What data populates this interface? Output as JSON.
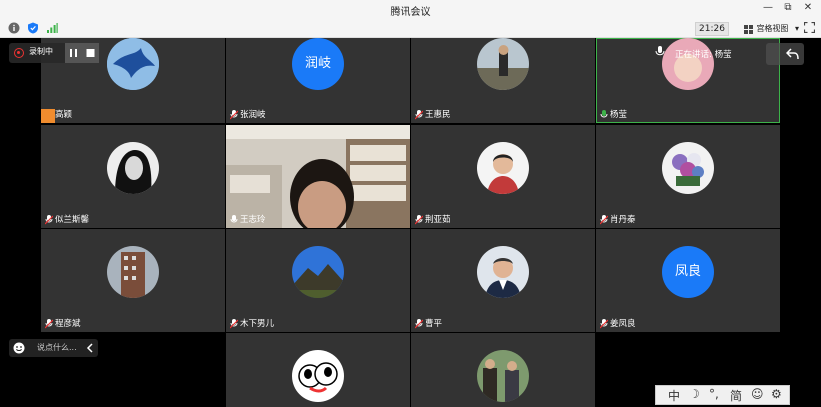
{
  "window": {
    "title": "腾讯会议",
    "min": "—",
    "restore": "⧉",
    "close": "✕"
  },
  "toolbar": {
    "time": "21:26",
    "grid_view_label": "宫格视图",
    "grid_view_arrow": "▾"
  },
  "recording": {
    "label": "录制中"
  },
  "speaking": {
    "label": "正在讲话: 杨莹"
  },
  "participants": [
    {
      "name": "高颖",
      "avatar": "bird"
    },
    {
      "name": "张润岐",
      "avatar_text": "润岐"
    },
    {
      "name": "王惠民",
      "avatar": "person-outdoor"
    },
    {
      "name": "杨莹",
      "avatar": "pink",
      "active": true
    },
    {
      "name": "似兰斯馨",
      "avatar": "woman-bw"
    },
    {
      "name": "王志玲",
      "avatar": "video"
    },
    {
      "name": "荆亚茹",
      "avatar": "woman-red"
    },
    {
      "name": "肖丹秦",
      "avatar": "flowers"
    },
    {
      "name": "程彦斌",
      "avatar": "building"
    },
    {
      "name": "木下男儿",
      "avatar": "mountain"
    },
    {
      "name": "曹平",
      "avatar": "man-suit"
    },
    {
      "name": "姜凤良",
      "avatar_text": "凤良"
    },
    {
      "name": "",
      "avatar": "cartoon"
    },
    {
      "name": "",
      "avatar": "two-men"
    }
  ],
  "chat": {
    "placeholder": "说点什么..."
  },
  "ime": {
    "items": [
      "中",
      "☽",
      "°,",
      "简",
      "☺",
      "⚙"
    ]
  }
}
